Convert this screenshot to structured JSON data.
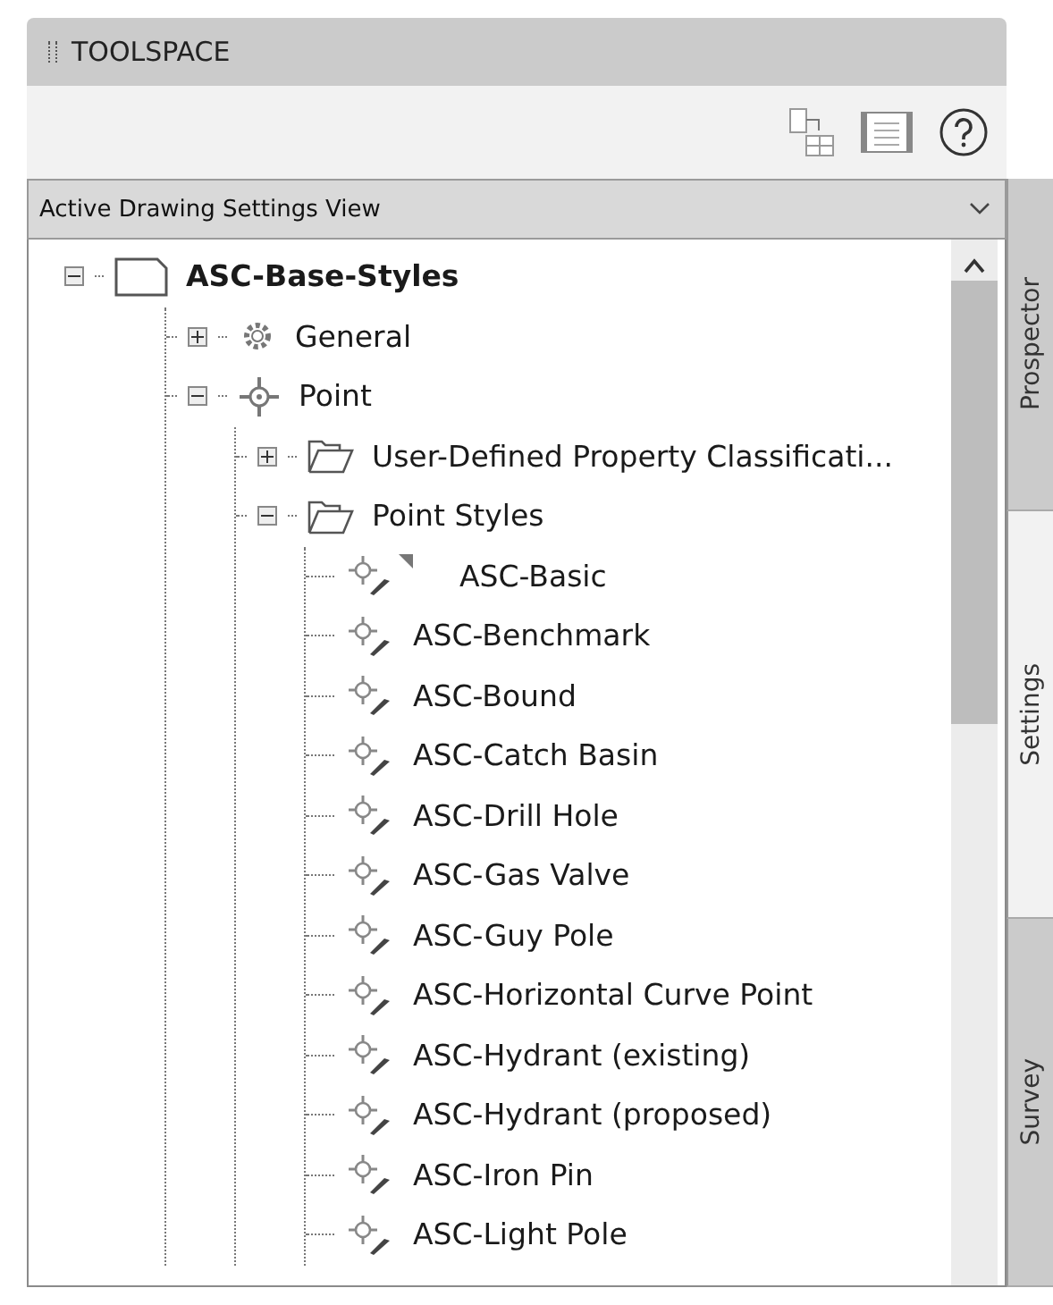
{
  "panel": {
    "title": "TOOLSPACE"
  },
  "view_selector": {
    "value": "Active Drawing Settings View"
  },
  "tree": [
    {
      "label": "ASC-Base-Styles",
      "kind": "document",
      "expanded": true,
      "children": [
        {
          "label": "General",
          "kind": "gear",
          "expanded": false
        },
        {
          "label": "Point",
          "kind": "point",
          "expanded": true,
          "children": [
            {
              "label": "User-Defined Property Classificati...",
              "kind": "folder",
              "expanded": false
            },
            {
              "label": "Point Styles",
              "kind": "folder",
              "expanded": true,
              "children": [
                {
                  "label": "ASC-Basic",
                  "kind": "style",
                  "flagged": true
                },
                {
                  "label": "ASC-Benchmark",
                  "kind": "style",
                  "flagged": false
                },
                {
                  "label": "ASC-Bound",
                  "kind": "style",
                  "flagged": false
                },
                {
                  "label": "ASC-Catch Basin",
                  "kind": "style",
                  "flagged": false
                },
                {
                  "label": "ASC-Drill Hole",
                  "kind": "style",
                  "flagged": false
                },
                {
                  "label": "ASC-Gas Valve",
                  "kind": "style",
                  "flagged": false
                },
                {
                  "label": "ASC-Guy Pole",
                  "kind": "style",
                  "flagged": false
                },
                {
                  "label": "ASC-Horizontal Curve Point",
                  "kind": "style",
                  "flagged": false
                },
                {
                  "label": "ASC-Hydrant (existing)",
                  "kind": "style",
                  "flagged": false
                },
                {
                  "label": "ASC-Hydrant (proposed)",
                  "kind": "style",
                  "flagged": false
                },
                {
                  "label": "ASC-Iron Pin",
                  "kind": "style",
                  "flagged": false
                },
                {
                  "label": "ASC-Light Pole",
                  "kind": "style",
                  "flagged": false
                }
              ]
            }
          ]
        }
      ]
    }
  ],
  "side_tabs": [
    {
      "label": "Prospector",
      "selected": false
    },
    {
      "label": "Settings",
      "selected": true
    },
    {
      "label": "Survey",
      "selected": false
    }
  ]
}
